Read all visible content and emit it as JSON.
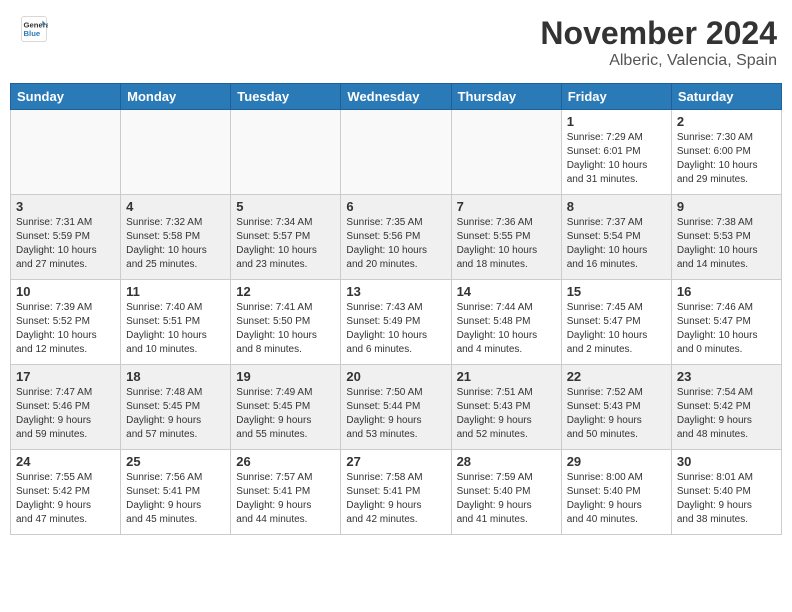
{
  "header": {
    "logo_general": "General",
    "logo_blue": "Blue",
    "month": "November 2024",
    "location": "Alberic, Valencia, Spain"
  },
  "days_of_week": [
    "Sunday",
    "Monday",
    "Tuesday",
    "Wednesday",
    "Thursday",
    "Friday",
    "Saturday"
  ],
  "weeks": [
    {
      "alt": false,
      "days": [
        {
          "num": "",
          "info": ""
        },
        {
          "num": "",
          "info": ""
        },
        {
          "num": "",
          "info": ""
        },
        {
          "num": "",
          "info": ""
        },
        {
          "num": "",
          "info": ""
        },
        {
          "num": "1",
          "info": "Sunrise: 7:29 AM\nSunset: 6:01 PM\nDaylight: 10 hours\nand 31 minutes."
        },
        {
          "num": "2",
          "info": "Sunrise: 7:30 AM\nSunset: 6:00 PM\nDaylight: 10 hours\nand 29 minutes."
        }
      ]
    },
    {
      "alt": true,
      "days": [
        {
          "num": "3",
          "info": "Sunrise: 7:31 AM\nSunset: 5:59 PM\nDaylight: 10 hours\nand 27 minutes."
        },
        {
          "num": "4",
          "info": "Sunrise: 7:32 AM\nSunset: 5:58 PM\nDaylight: 10 hours\nand 25 minutes."
        },
        {
          "num": "5",
          "info": "Sunrise: 7:34 AM\nSunset: 5:57 PM\nDaylight: 10 hours\nand 23 minutes."
        },
        {
          "num": "6",
          "info": "Sunrise: 7:35 AM\nSunset: 5:56 PM\nDaylight: 10 hours\nand 20 minutes."
        },
        {
          "num": "7",
          "info": "Sunrise: 7:36 AM\nSunset: 5:55 PM\nDaylight: 10 hours\nand 18 minutes."
        },
        {
          "num": "8",
          "info": "Sunrise: 7:37 AM\nSunset: 5:54 PM\nDaylight: 10 hours\nand 16 minutes."
        },
        {
          "num": "9",
          "info": "Sunrise: 7:38 AM\nSunset: 5:53 PM\nDaylight: 10 hours\nand 14 minutes."
        }
      ]
    },
    {
      "alt": false,
      "days": [
        {
          "num": "10",
          "info": "Sunrise: 7:39 AM\nSunset: 5:52 PM\nDaylight: 10 hours\nand 12 minutes."
        },
        {
          "num": "11",
          "info": "Sunrise: 7:40 AM\nSunset: 5:51 PM\nDaylight: 10 hours\nand 10 minutes."
        },
        {
          "num": "12",
          "info": "Sunrise: 7:41 AM\nSunset: 5:50 PM\nDaylight: 10 hours\nand 8 minutes."
        },
        {
          "num": "13",
          "info": "Sunrise: 7:43 AM\nSunset: 5:49 PM\nDaylight: 10 hours\nand 6 minutes."
        },
        {
          "num": "14",
          "info": "Sunrise: 7:44 AM\nSunset: 5:48 PM\nDaylight: 10 hours\nand 4 minutes."
        },
        {
          "num": "15",
          "info": "Sunrise: 7:45 AM\nSunset: 5:47 PM\nDaylight: 10 hours\nand 2 minutes."
        },
        {
          "num": "16",
          "info": "Sunrise: 7:46 AM\nSunset: 5:47 PM\nDaylight: 10 hours\nand 0 minutes."
        }
      ]
    },
    {
      "alt": true,
      "days": [
        {
          "num": "17",
          "info": "Sunrise: 7:47 AM\nSunset: 5:46 PM\nDaylight: 9 hours\nand 59 minutes."
        },
        {
          "num": "18",
          "info": "Sunrise: 7:48 AM\nSunset: 5:45 PM\nDaylight: 9 hours\nand 57 minutes."
        },
        {
          "num": "19",
          "info": "Sunrise: 7:49 AM\nSunset: 5:45 PM\nDaylight: 9 hours\nand 55 minutes."
        },
        {
          "num": "20",
          "info": "Sunrise: 7:50 AM\nSunset: 5:44 PM\nDaylight: 9 hours\nand 53 minutes."
        },
        {
          "num": "21",
          "info": "Sunrise: 7:51 AM\nSunset: 5:43 PM\nDaylight: 9 hours\nand 52 minutes."
        },
        {
          "num": "22",
          "info": "Sunrise: 7:52 AM\nSunset: 5:43 PM\nDaylight: 9 hours\nand 50 minutes."
        },
        {
          "num": "23",
          "info": "Sunrise: 7:54 AM\nSunset: 5:42 PM\nDaylight: 9 hours\nand 48 minutes."
        }
      ]
    },
    {
      "alt": false,
      "days": [
        {
          "num": "24",
          "info": "Sunrise: 7:55 AM\nSunset: 5:42 PM\nDaylight: 9 hours\nand 47 minutes."
        },
        {
          "num": "25",
          "info": "Sunrise: 7:56 AM\nSunset: 5:41 PM\nDaylight: 9 hours\nand 45 minutes."
        },
        {
          "num": "26",
          "info": "Sunrise: 7:57 AM\nSunset: 5:41 PM\nDaylight: 9 hours\nand 44 minutes."
        },
        {
          "num": "27",
          "info": "Sunrise: 7:58 AM\nSunset: 5:41 PM\nDaylight: 9 hours\nand 42 minutes."
        },
        {
          "num": "28",
          "info": "Sunrise: 7:59 AM\nSunset: 5:40 PM\nDaylight: 9 hours\nand 41 minutes."
        },
        {
          "num": "29",
          "info": "Sunrise: 8:00 AM\nSunset: 5:40 PM\nDaylight: 9 hours\nand 40 minutes."
        },
        {
          "num": "30",
          "info": "Sunrise: 8:01 AM\nSunset: 5:40 PM\nDaylight: 9 hours\nand 38 minutes."
        }
      ]
    }
  ]
}
